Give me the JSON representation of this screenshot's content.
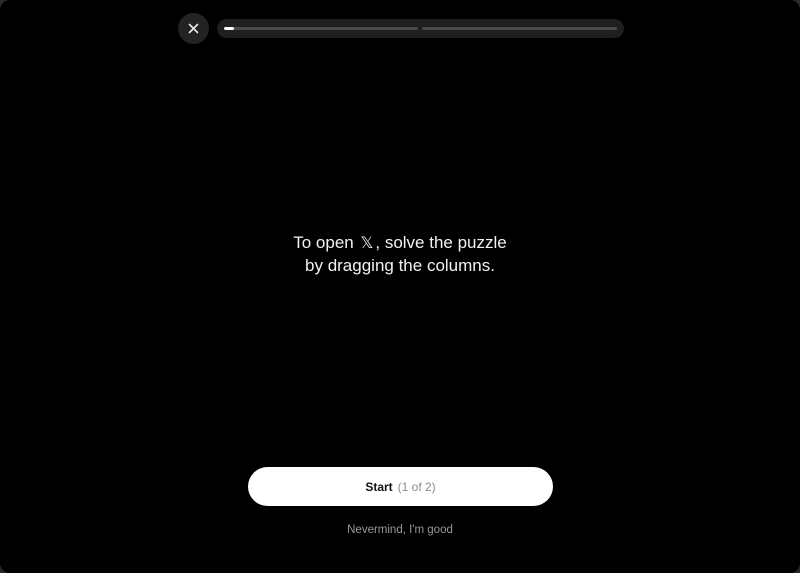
{
  "header": {
    "close_icon": "close-icon",
    "progress": {
      "segments": [
        {
          "label": "step-1",
          "progress_fraction": 0.05
        },
        {
          "label": "step-2",
          "progress_fraction": 0.0
        }
      ]
    }
  },
  "main": {
    "line1_before": "To open",
    "brand_glyph": "𝕏",
    "line1_after": ", solve the puzzle",
    "line2": "by dragging the columns."
  },
  "actions": {
    "start_label": "Start",
    "start_step": "(1 of 2)",
    "nevermind_label": "Nevermind, I'm good"
  },
  "colors": {
    "background": "#000000",
    "button": "#ffffff",
    "progress_track": "#4a4a4a",
    "progress_fill": "#ffffff"
  }
}
